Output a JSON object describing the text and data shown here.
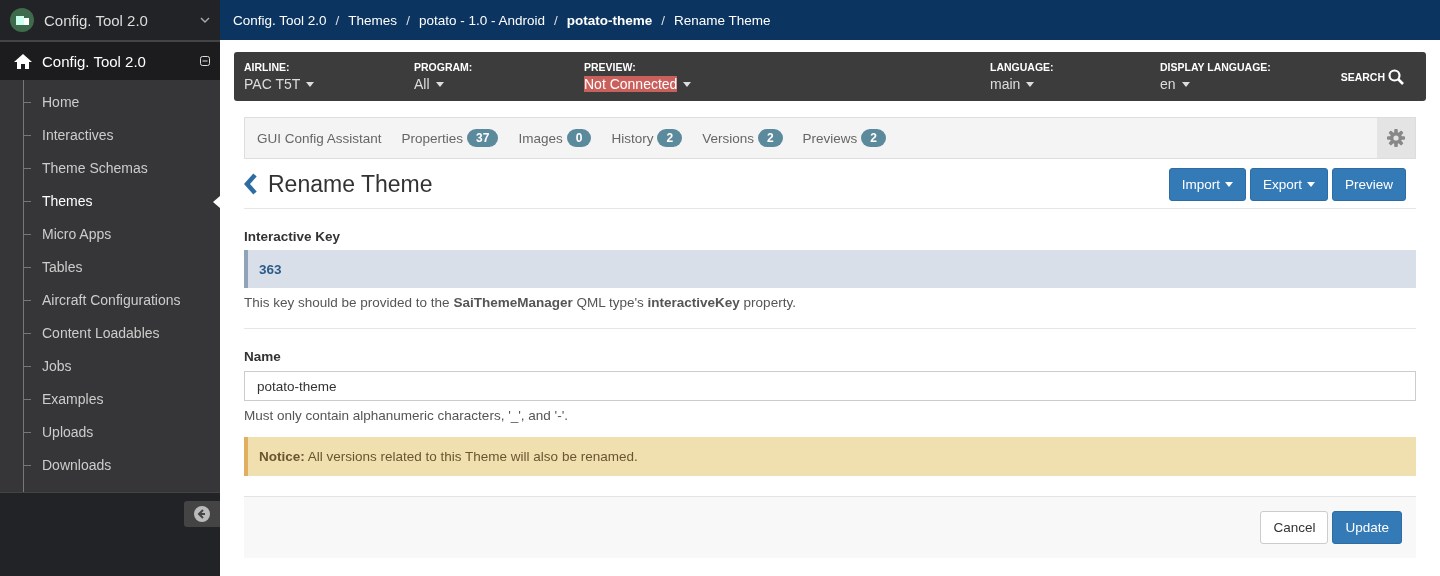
{
  "app_switcher": {
    "title": "Config. Tool 2.0"
  },
  "sidebar": {
    "title": "Config. Tool 2.0",
    "items": [
      {
        "label": "Home",
        "selected": false
      },
      {
        "label": "Interactives",
        "selected": false
      },
      {
        "label": "Theme Schemas",
        "selected": false
      },
      {
        "label": "Themes",
        "selected": true
      },
      {
        "label": "Micro Apps",
        "selected": false
      },
      {
        "label": "Tables",
        "selected": false
      },
      {
        "label": "Aircraft Configurations",
        "selected": false
      },
      {
        "label": "Content Loadables",
        "selected": false
      },
      {
        "label": "Jobs",
        "selected": false
      },
      {
        "label": "Examples",
        "selected": false
      },
      {
        "label": "Uploads",
        "selected": false
      },
      {
        "label": "Downloads",
        "selected": false
      }
    ]
  },
  "breadcrumb": [
    {
      "label": "Config. Tool 2.0",
      "kind": "link"
    },
    {
      "separator": "/",
      "label": "Themes",
      "kind": "link"
    },
    {
      "separator": "/",
      "label": "potato - 1.0 - Android",
      "kind": "link"
    },
    {
      "separator": "/",
      "label": "potato-theme",
      "kind": "strong"
    },
    {
      "separator": "/",
      "label": "Rename Theme",
      "kind": "plain"
    }
  ],
  "filters": [
    {
      "label": "AIRLINE:",
      "value": "PAC T5T",
      "alert": false
    },
    {
      "label": "PROGRAM:",
      "value": "All",
      "alert": false
    },
    {
      "label": "PREVIEW:",
      "value": "Not Connected",
      "alert": true
    },
    {
      "label": "LANGUAGE:",
      "value": "main",
      "alert": false
    },
    {
      "label": "DISPLAY LANGUAGE:",
      "value": "en",
      "alert": false
    }
  ],
  "search": {
    "label": "SEARCH"
  },
  "tabs": [
    {
      "label": "GUI Config Assistant"
    },
    {
      "label": "Properties",
      "count": "37"
    },
    {
      "label": "Images",
      "count": "0"
    },
    {
      "label": "History",
      "count": "2"
    },
    {
      "label": "Versions",
      "count": "2"
    },
    {
      "label": "Previews",
      "count": "2"
    }
  ],
  "page": {
    "title": "Rename Theme",
    "buttons": [
      {
        "label": "Import",
        "dropdown": true
      },
      {
        "label": "Export",
        "dropdown": true
      },
      {
        "label": "Preview",
        "dropdown": false
      }
    ]
  },
  "interactive_key": {
    "label": "Interactive Key",
    "value": "363",
    "help": "This key should be provided to the **SaiThemeManager** QML type's **interactiveKey** property."
  },
  "name_field": {
    "label": "Name",
    "value": "potato-theme",
    "help": "Must only contain alphanumeric characters, '_', and '-'."
  },
  "notice": {
    "text": "**Notice:** All versions related to this Theme will also be renamed."
  },
  "footer_buttons": [
    {
      "label": "Cancel",
      "kind": "default"
    },
    {
      "label": "Update",
      "kind": "primary"
    }
  ]
}
